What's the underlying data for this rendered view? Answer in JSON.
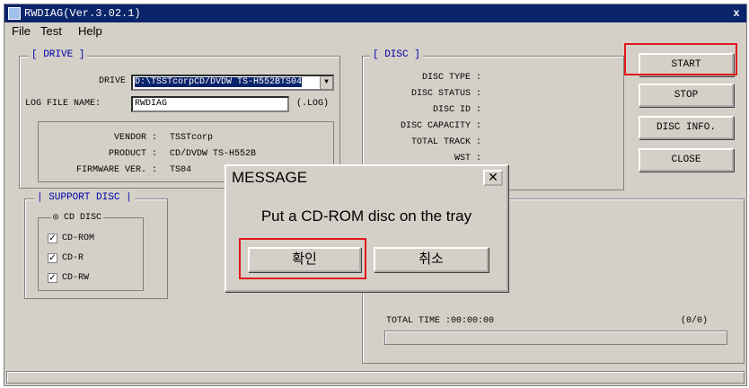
{
  "window": {
    "title": "RWDIAG(Ver.3.02.1)",
    "close_glyph": "x"
  },
  "menu": {
    "file": "File",
    "test": "Test",
    "help": "Help"
  },
  "drive_group": {
    "title": "[ DRIVE ]",
    "drive_label": "DRIVE :",
    "drive_value": "D:\\TSSTcorpCD/DVDW TS-H552BTS04",
    "log_label": "LOG FILE NAME:",
    "log_value": "RWDIAG",
    "log_ext": "(.LOG)",
    "vendor_label": "VENDOR :",
    "vendor_value": "TSSTcorp",
    "product_label": "PRODUCT :",
    "product_value": "CD/DVDW TS-H552B",
    "firmware_label": "FIRMWARE VER. :",
    "firmware_value": "TS04"
  },
  "support_group": {
    "title": "| SUPPORT DISC |",
    "sub_title": "CD DISC",
    "items": [
      {
        "label": "CD-ROM",
        "checked": "✓"
      },
      {
        "label": "CD-R",
        "checked": "✓"
      },
      {
        "label": "CD-RW",
        "checked": "✓"
      }
    ]
  },
  "disc_group": {
    "title": "[ DISC ]",
    "labels": [
      "DISC TYPE :",
      "DISC STATUS :",
      "DISC ID :",
      "DISC CAPACITY :",
      "TOTAL TRACK :",
      "WST :"
    ]
  },
  "buttons": {
    "start": "START",
    "stop": "STOP",
    "disc_info": "DISC INFO.",
    "close": "CLOSE"
  },
  "progress": {
    "total_time": "TOTAL TIME :00:00:00",
    "count": "(0/0)"
  },
  "dialog": {
    "title": "MESSAGE",
    "close_glyph": "✕",
    "message": "Put a CD-ROM disc on the tray",
    "ok": "확인",
    "cancel": "취소"
  },
  "colors": {
    "highlight": "#e0191e",
    "titlebar": "#0a246a",
    "face": "#d4d0c8",
    "group_title": "#0000aa"
  }
}
